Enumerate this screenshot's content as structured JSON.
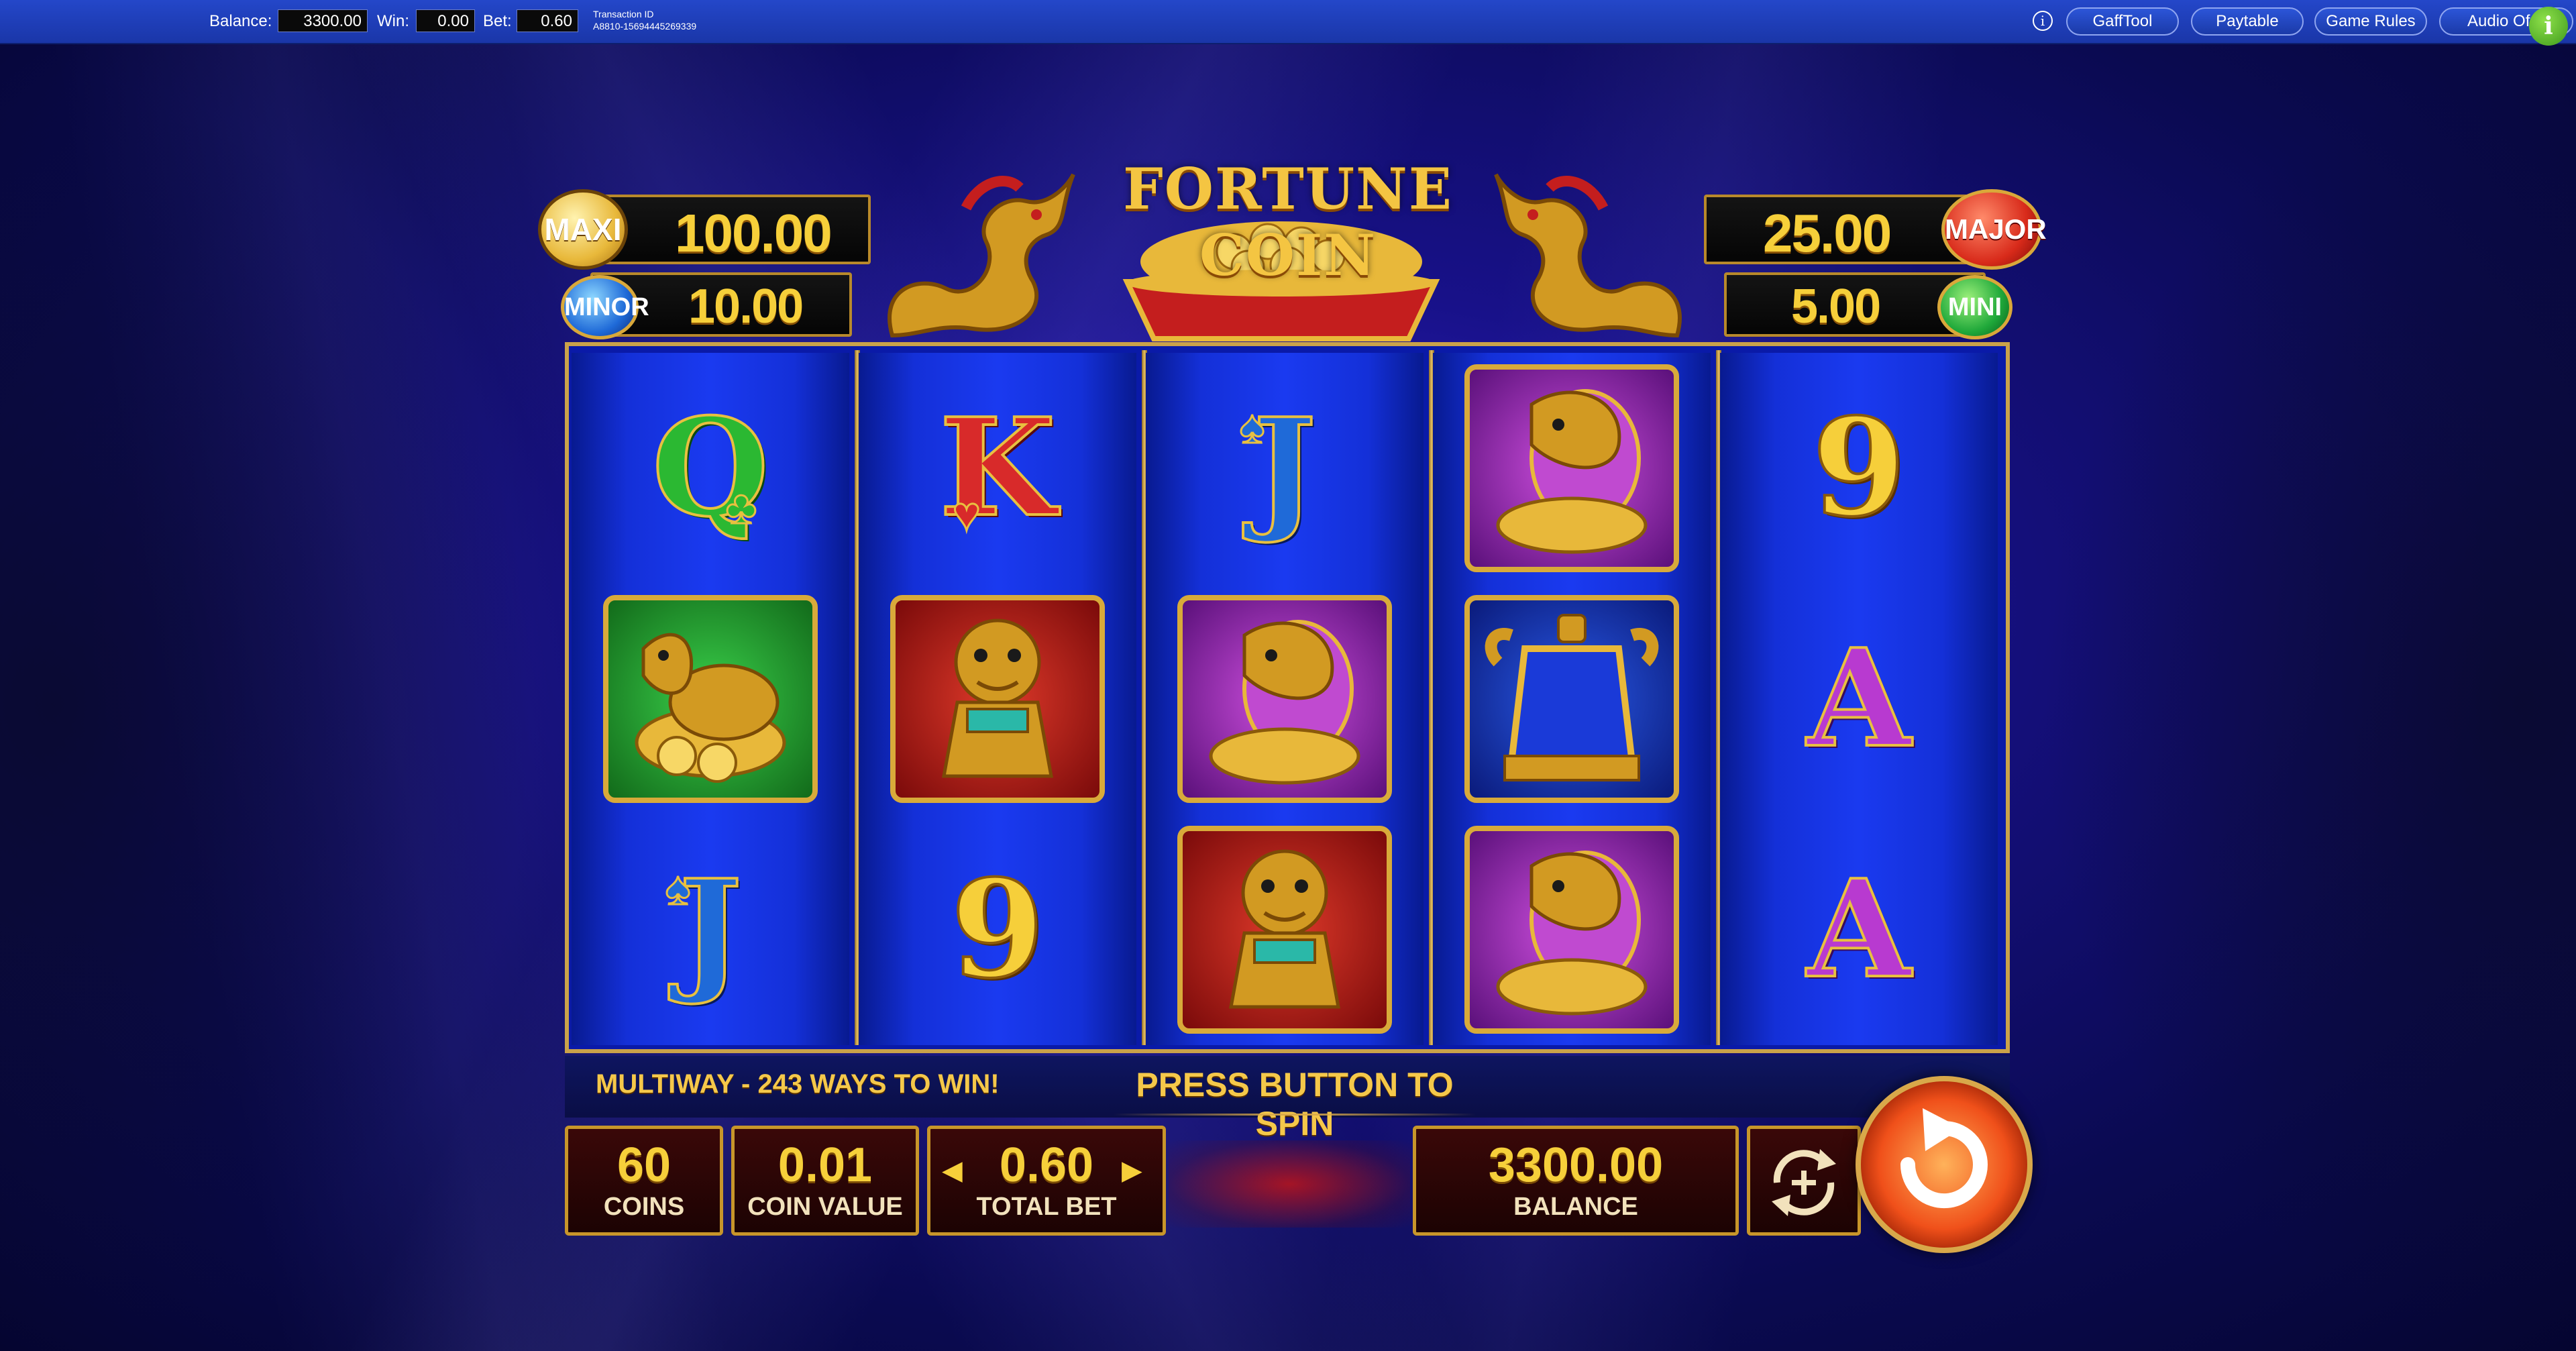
{
  "topbar": {
    "balance_label": "Balance:",
    "balance_value": "3300.00",
    "win_label": "Win:",
    "win_value": "0.00",
    "bet_label": "Bet:",
    "bet_value": "0.60",
    "transaction_label": "Transaction ID",
    "transaction_id": "A8810-15694445269339",
    "buttons": [
      "GaffTool",
      "Paytable",
      "Game Rules",
      "Audio Of"
    ]
  },
  "game": {
    "title": "FORTUNE COIN",
    "jackpots": {
      "maxi": {
        "label": "MAXI",
        "value": "100.00"
      },
      "minor": {
        "label": "MINOR",
        "value": "10.00"
      },
      "major": {
        "label": "MAJOR",
        "value": "25.00"
      },
      "mini": {
        "label": "MINI",
        "value": "5.00"
      }
    },
    "reels": [
      [
        "Q",
        "dragon-turtle",
        "J"
      ],
      [
        "K",
        "foo-dog",
        "9"
      ],
      [
        "J",
        "golden-carp",
        "foo-dog"
      ],
      [
        "golden-carp",
        "golden-bell",
        "golden-carp"
      ],
      [
        "9",
        "A",
        "A"
      ]
    ],
    "message_left": "MULTIWAY - 243 WAYS TO WIN!",
    "message_center": "PRESS BUTTON TO SPIN",
    "coins": {
      "value": "60",
      "label": "COINS"
    },
    "coin_value": {
      "value": "0.01",
      "label": "COIN VALUE"
    },
    "total_bet": {
      "value": "0.60",
      "label": "TOTAL BET"
    },
    "balance": {
      "value": "3300.00",
      "label": "BALANCE"
    }
  },
  "colors": {
    "topbar": "#1f3fbf",
    "gold": "#f6cf3a",
    "reel_blue": "#1a3af0",
    "panel_red": "#3a0808",
    "spin_orange": "#f0501a"
  }
}
